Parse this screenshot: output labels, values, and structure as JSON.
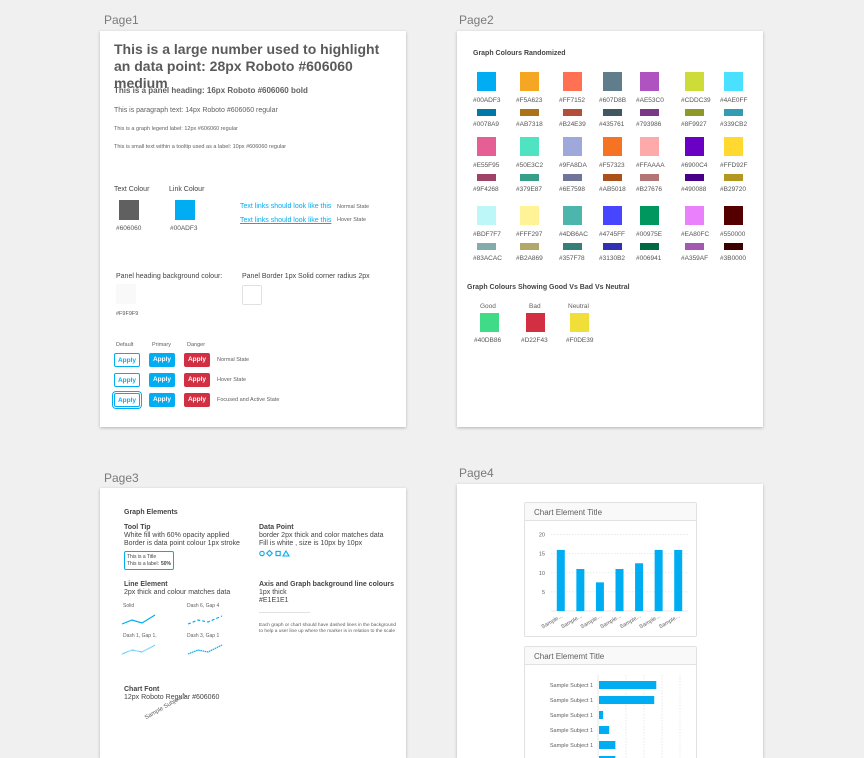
{
  "page_labels": [
    "Page1",
    "Page2",
    "Page3",
    "Page4"
  ],
  "page1": {
    "large_number": "This is a large number used to highlight an data point: 28px Roboto #606060 medium",
    "panel_heading": "This is a panel heading: 16px Roboto #606060 bold",
    "paragraph": "This is paragraph text: 14px Roboto #606060 regular",
    "legend_label": "This is a graph legend label: 12px #606060 regular",
    "small_text": "This is small text within a tooltip used as a label: 10px #606060 regular",
    "text_colour_label": "Text Colour",
    "text_colour_hex": "#606060",
    "link_colour_label": "Link Colour",
    "link_colour_hex": "#00ADF3",
    "link_text": "Text links should look like this",
    "normal_state": "Normal State",
    "hover_state": "Hover State",
    "panel_bg_label": "Panel heading background colour:",
    "panel_bg_hex": "#F9F9F9",
    "panel_border_label": "Panel Border 1px Solid corner radius 2px",
    "btn_headers": [
      "Default",
      "Primary",
      "Danger"
    ],
    "btn_label": "Apply",
    "state_labels": [
      "Normal State",
      "Hover State",
      "Focused and Active State"
    ]
  },
  "page2": {
    "title": "Graph Colours Randomized",
    "palette": [
      [
        [
          [
            "#00ADF3",
            "#00ADF3"
          ],
          [
            "#0078A9",
            "#0078A9"
          ]
        ],
        [
          [
            "#F5A623",
            "#F5A623"
          ],
          [
            "#AB7318",
            "#AB7318"
          ]
        ],
        [
          [
            "#FF7152",
            "#FF7152"
          ],
          [
            "#B24E39",
            "#B24E39"
          ]
        ],
        [
          [
            "#607D8B",
            "#607D8B"
          ],
          [
            "#435761",
            "#435761"
          ]
        ],
        [
          [
            "#AE53C0",
            "#AE53C0"
          ],
          [
            "#793986",
            "#793986"
          ]
        ],
        [
          [
            "#CDDC39",
            "#CDDC39"
          ],
          [
            "#8F9927",
            "#8F9927"
          ]
        ],
        [
          [
            "#4AE0FF",
            "#4AE0FF"
          ],
          [
            "#339CB2",
            "#339CB2"
          ]
        ]
      ],
      [
        [
          [
            "#E55F95",
            "#E55F95"
          ],
          [
            "#9F4268",
            "#9F4268"
          ]
        ],
        [
          [
            "#50E3C2",
            "#50E3C2"
          ],
          [
            "#379E87",
            "#379E87"
          ]
        ],
        [
          [
            "#9FA8DA",
            "#9FA8DA"
          ],
          [
            "#6E7598",
            "#6E7598"
          ]
        ],
        [
          [
            "#F57323",
            "#F57323"
          ],
          [
            "#AB5018",
            "#AB5018"
          ]
        ],
        [
          [
            "#FFAAAA",
            "#FFAAAA"
          ],
          [
            "#B27676",
            "#B27676"
          ]
        ],
        [
          [
            "#6900C4",
            "#6900C4"
          ],
          [
            "#490088",
            "#490088"
          ]
        ],
        [
          [
            "#FFD92F",
            "#FFD92F"
          ],
          [
            "#B29720",
            "#B29720"
          ]
        ]
      ],
      [
        [
          [
            "#BDF7F7",
            "#BDF7F7"
          ],
          [
            "#83ACAC",
            "#83ACAC"
          ]
        ],
        [
          [
            "#FFF297",
            "#FFF297"
          ],
          [
            "#B2A869",
            "#B2A869"
          ]
        ],
        [
          [
            "#4DB6AC",
            "#4DB6AC"
          ],
          [
            "#357F78",
            "#357F78"
          ]
        ],
        [
          [
            "#4745FF",
            "#4745FF"
          ],
          [
            "#3130B2",
            "#3130B2"
          ]
        ],
        [
          [
            "#00975E",
            "#00975E"
          ],
          [
            "#006941",
            "#006941"
          ]
        ],
        [
          [
            "#EA80FC",
            "#EA80FC"
          ],
          [
            "#A359AF",
            "#A359AF"
          ]
        ],
        [
          [
            "#550000",
            "#550000"
          ],
          [
            "#3B0000",
            "#3B0000"
          ]
        ]
      ]
    ],
    "gbn_title": "Graph Colours Showing Good Vs Bad Vs Neutral",
    "gbn": [
      {
        "label": "Good",
        "hex": "#40DB86",
        "color": "#40DB86"
      },
      {
        "label": "Bad",
        "hex": "#D22F43",
        "color": "#D22F43"
      },
      {
        "label": "Neutral",
        "hex": "#F0DE39",
        "color": "#F0DE39"
      }
    ]
  },
  "page3": {
    "title": "Graph Elements",
    "tooltip_head": "Tool Tip",
    "tooltip_l1": "White fill with 60% opacity applied",
    "tooltip_l2": "Border is data point colour 1px stroke",
    "tooltip_title": "This is a Title",
    "tooltip_label": "This is a label:",
    "tooltip_value": "50%",
    "datapoint_head": "Data Point",
    "datapoint_l1": "border 2px thick and color matches data",
    "datapoint_l2": "Fill is white , size is 10px by 10px",
    "line_head": "Line Element",
    "line_l1": "2px thick and colour matches data",
    "line_labels": [
      "Solid",
      "Dash 6, Gap 4",
      "Dash 1, Gap 1,",
      "Dash 3, Gap 1"
    ],
    "axis_head": "Axis and Graph background line colours",
    "axis_l1": "1px thick",
    "axis_l2": "#E1E1E1",
    "axis_note1": "Each graph or chart should have dashed lines in the background",
    "axis_note2": "to help a user line up where the marker is in relation to the scale",
    "font_head": "Chart Font",
    "font_l1": "12px Roboto Regular #606060",
    "font_sample": "Sample Subject 1"
  },
  "page4": {
    "chart1_title": "Chart Element Title",
    "chart2_title": "Chart Elememt Title"
  },
  "chart_data": [
    {
      "type": "bar",
      "title": "Chart Element Title",
      "categories": [
        "Sample...",
        "Sample...",
        "Sample...",
        "Sample...",
        "Sample...",
        "Sample...",
        "Sample..."
      ],
      "values": [
        16,
        11,
        7.5,
        11,
        12.5,
        16,
        16
      ],
      "yticks": [
        5,
        10,
        15,
        20
      ],
      "ylim": [
        0,
        22
      ],
      "color": "#00ADF3",
      "grid": true
    },
    {
      "type": "bar",
      "orientation": "horizontal",
      "title": "Chart Elememt Title",
      "categories": [
        "Sample Subject 1",
        "Sample Subject 1",
        "Sample Subject 1",
        "Sample Subject 1",
        "Sample Subject 1",
        "Sample Subject 1"
      ],
      "values": [
        14,
        13.5,
        1,
        2.5,
        4,
        4
      ],
      "xlim": [
        0,
        22
      ],
      "color": "#00ADF3",
      "grid": true
    }
  ]
}
